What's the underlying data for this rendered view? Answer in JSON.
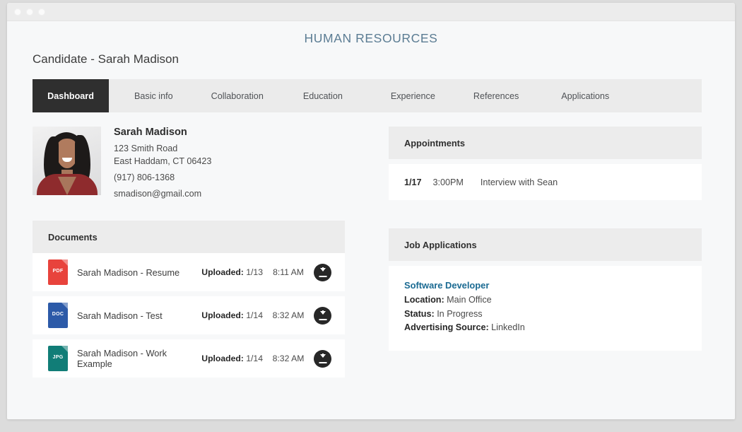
{
  "window": {
    "dots": [
      "close-dot",
      "minimize-dot",
      "maximize-dot"
    ]
  },
  "header": {
    "app_title": "HUMAN RESOURCES",
    "page_title": "Candidate - Sarah Madison"
  },
  "tabs": [
    {
      "label": "Dashboard",
      "active": true
    },
    {
      "label": "Basic info",
      "active": false
    },
    {
      "label": "Collaboration",
      "active": false
    },
    {
      "label": "Education",
      "active": false
    },
    {
      "label": "Experience",
      "active": false
    },
    {
      "label": "References",
      "active": false
    },
    {
      "label": "Applications",
      "active": false
    }
  ],
  "profile": {
    "name": "Sarah Madison",
    "address_line1": "123 Smith Road",
    "address_line2": "East Haddam, CT 06423",
    "phone": "(917) 806-1368",
    "email": "smadison@gmail.com"
  },
  "documents": {
    "panel_title": "Documents",
    "uploaded_label": "Uploaded:",
    "rows": [
      {
        "file_type": "PDF",
        "color": "#e8433c",
        "name": "Sarah Madison - Resume",
        "date": "1/13",
        "time": "8:11 AM",
        "download": "download-icon"
      },
      {
        "file_type": "DOC",
        "color": "#2c5aa8",
        "name": "Sarah Madison - Test",
        "date": "1/14",
        "time": "8:32 AM",
        "download": "download-icon"
      },
      {
        "file_type": "JPG",
        "color": "#117d77",
        "name": "Sarah Madison - Work Example",
        "date": "1/14",
        "time": "8:32 AM",
        "download": "download-icon"
      }
    ]
  },
  "appointments": {
    "panel_title": "Appointments",
    "rows": [
      {
        "date": "1/17",
        "time": "3:00PM",
        "description": "Interview with Sean"
      }
    ]
  },
  "job_applications": {
    "panel_title": "Job Applications",
    "items": [
      {
        "title": "Software Developer",
        "location_label": "Location:",
        "location": "Main Office",
        "status_label": "Status:",
        "status": "In Progress",
        "source_label": "Advertising Source:",
        "source": "LinkedIn"
      }
    ]
  },
  "colors": {
    "accent_title": "#5b7c93",
    "link": "#1a6a92",
    "active_tab_bg": "#2f2f2f",
    "panel_header_bg": "#ececec",
    "page_bg": "#f7f8f9"
  }
}
